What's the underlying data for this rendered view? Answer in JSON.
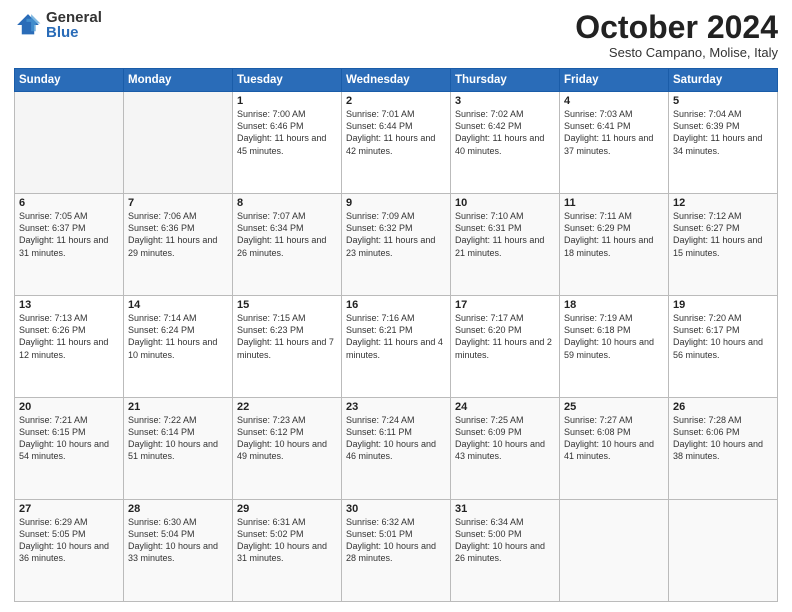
{
  "logo": {
    "general": "General",
    "blue": "Blue"
  },
  "title": "October 2024",
  "subtitle": "Sesto Campano, Molise, Italy",
  "columns": [
    "Sunday",
    "Monday",
    "Tuesday",
    "Wednesday",
    "Thursday",
    "Friday",
    "Saturday"
  ],
  "weeks": [
    [
      {
        "day": "",
        "info": ""
      },
      {
        "day": "",
        "info": ""
      },
      {
        "day": "1",
        "info": "Sunrise: 7:00 AM\nSunset: 6:46 PM\nDaylight: 11 hours and 45 minutes."
      },
      {
        "day": "2",
        "info": "Sunrise: 7:01 AM\nSunset: 6:44 PM\nDaylight: 11 hours and 42 minutes."
      },
      {
        "day": "3",
        "info": "Sunrise: 7:02 AM\nSunset: 6:42 PM\nDaylight: 11 hours and 40 minutes."
      },
      {
        "day": "4",
        "info": "Sunrise: 7:03 AM\nSunset: 6:41 PM\nDaylight: 11 hours and 37 minutes."
      },
      {
        "day": "5",
        "info": "Sunrise: 7:04 AM\nSunset: 6:39 PM\nDaylight: 11 hours and 34 minutes."
      }
    ],
    [
      {
        "day": "6",
        "info": "Sunrise: 7:05 AM\nSunset: 6:37 PM\nDaylight: 11 hours and 31 minutes."
      },
      {
        "day": "7",
        "info": "Sunrise: 7:06 AM\nSunset: 6:36 PM\nDaylight: 11 hours and 29 minutes."
      },
      {
        "day": "8",
        "info": "Sunrise: 7:07 AM\nSunset: 6:34 PM\nDaylight: 11 hours and 26 minutes."
      },
      {
        "day": "9",
        "info": "Sunrise: 7:09 AM\nSunset: 6:32 PM\nDaylight: 11 hours and 23 minutes."
      },
      {
        "day": "10",
        "info": "Sunrise: 7:10 AM\nSunset: 6:31 PM\nDaylight: 11 hours and 21 minutes."
      },
      {
        "day": "11",
        "info": "Sunrise: 7:11 AM\nSunset: 6:29 PM\nDaylight: 11 hours and 18 minutes."
      },
      {
        "day": "12",
        "info": "Sunrise: 7:12 AM\nSunset: 6:27 PM\nDaylight: 11 hours and 15 minutes."
      }
    ],
    [
      {
        "day": "13",
        "info": "Sunrise: 7:13 AM\nSunset: 6:26 PM\nDaylight: 11 hours and 12 minutes."
      },
      {
        "day": "14",
        "info": "Sunrise: 7:14 AM\nSunset: 6:24 PM\nDaylight: 11 hours and 10 minutes."
      },
      {
        "day": "15",
        "info": "Sunrise: 7:15 AM\nSunset: 6:23 PM\nDaylight: 11 hours and 7 minutes."
      },
      {
        "day": "16",
        "info": "Sunrise: 7:16 AM\nSunset: 6:21 PM\nDaylight: 11 hours and 4 minutes."
      },
      {
        "day": "17",
        "info": "Sunrise: 7:17 AM\nSunset: 6:20 PM\nDaylight: 11 hours and 2 minutes."
      },
      {
        "day": "18",
        "info": "Sunrise: 7:19 AM\nSunset: 6:18 PM\nDaylight: 10 hours and 59 minutes."
      },
      {
        "day": "19",
        "info": "Sunrise: 7:20 AM\nSunset: 6:17 PM\nDaylight: 10 hours and 56 minutes."
      }
    ],
    [
      {
        "day": "20",
        "info": "Sunrise: 7:21 AM\nSunset: 6:15 PM\nDaylight: 10 hours and 54 minutes."
      },
      {
        "day": "21",
        "info": "Sunrise: 7:22 AM\nSunset: 6:14 PM\nDaylight: 10 hours and 51 minutes."
      },
      {
        "day": "22",
        "info": "Sunrise: 7:23 AM\nSunset: 6:12 PM\nDaylight: 10 hours and 49 minutes."
      },
      {
        "day": "23",
        "info": "Sunrise: 7:24 AM\nSunset: 6:11 PM\nDaylight: 10 hours and 46 minutes."
      },
      {
        "day": "24",
        "info": "Sunrise: 7:25 AM\nSunset: 6:09 PM\nDaylight: 10 hours and 43 minutes."
      },
      {
        "day": "25",
        "info": "Sunrise: 7:27 AM\nSunset: 6:08 PM\nDaylight: 10 hours and 41 minutes."
      },
      {
        "day": "26",
        "info": "Sunrise: 7:28 AM\nSunset: 6:06 PM\nDaylight: 10 hours and 38 minutes."
      }
    ],
    [
      {
        "day": "27",
        "info": "Sunrise: 6:29 AM\nSunset: 5:05 PM\nDaylight: 10 hours and 36 minutes."
      },
      {
        "day": "28",
        "info": "Sunrise: 6:30 AM\nSunset: 5:04 PM\nDaylight: 10 hours and 33 minutes."
      },
      {
        "day": "29",
        "info": "Sunrise: 6:31 AM\nSunset: 5:02 PM\nDaylight: 10 hours and 31 minutes."
      },
      {
        "day": "30",
        "info": "Sunrise: 6:32 AM\nSunset: 5:01 PM\nDaylight: 10 hours and 28 minutes."
      },
      {
        "day": "31",
        "info": "Sunrise: 6:34 AM\nSunset: 5:00 PM\nDaylight: 10 hours and 26 minutes."
      },
      {
        "day": "",
        "info": ""
      },
      {
        "day": "",
        "info": ""
      }
    ]
  ]
}
